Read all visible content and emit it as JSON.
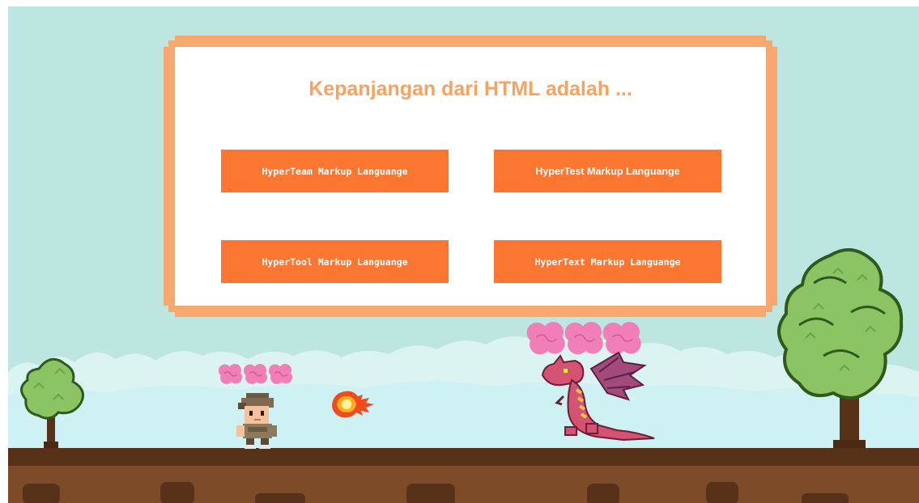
{
  "quiz": {
    "question": "Kepanjangan dari HTML adalah ...",
    "answers": [
      "HyperTeam Markup Languange",
      "HyperTest Markup Languange",
      "HyperTool Markup Languange",
      "HyperText Markup Languange"
    ]
  },
  "player": {
    "lives": 3
  },
  "enemy": {
    "lives": 3
  },
  "colors": {
    "sky": "#bde6e1",
    "panel_frame": "#f8a86e",
    "question_text": "#f6a262",
    "answer_button": "#fa7631",
    "life_brain": "#f07fb7",
    "ground_top": "#583218",
    "ground_fill": "#7c4b28"
  },
  "icons": {
    "lives": "brain-icon",
    "projectile": "fireball-icon",
    "player": "soldier-icon",
    "enemy": "dragon-icon"
  }
}
